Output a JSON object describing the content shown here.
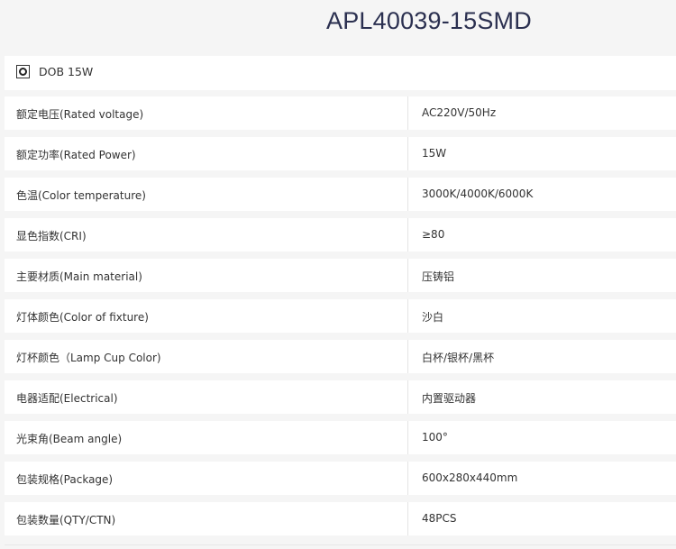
{
  "page": {
    "title": "APL40039-15SMD"
  },
  "header": {
    "icon": "dob-module-icon",
    "label": "DOB 15W"
  },
  "specs": [
    {
      "label": "额定电压(Rated voltage)",
      "value": "AC220V/50Hz"
    },
    {
      "label": "额定功率(Rated Power)",
      "value": "15W"
    },
    {
      "label": "色温(Color temperature)",
      "value": "3000K/4000K/6000K"
    },
    {
      "label": "显色指数(CRI)",
      "value": "≥80"
    },
    {
      "label": "主要材质(Main material)",
      "value": "压铸铝"
    },
    {
      "label": "灯体颜色(Color of fixture)",
      "value": "沙白"
    },
    {
      "label": "灯杯颜色（Lamp Cup Color)",
      "value": "白杯/银杯/黑杯"
    },
    {
      "label": "电器适配(Electrical)",
      "value": "内置驱动器"
    },
    {
      "label": "光束角(Beam angle)",
      "value": "100°"
    },
    {
      "label": "包装规格(Package)",
      "value": "600x280x440mm"
    },
    {
      "label": "包装数量(QTY/CTN)",
      "value": "48PCS"
    }
  ],
  "colors": {
    "background": "#f5f5f5",
    "row": "#ffffff",
    "title": "#2b3050",
    "text": "#333333",
    "divider": "#e4e4e4"
  }
}
